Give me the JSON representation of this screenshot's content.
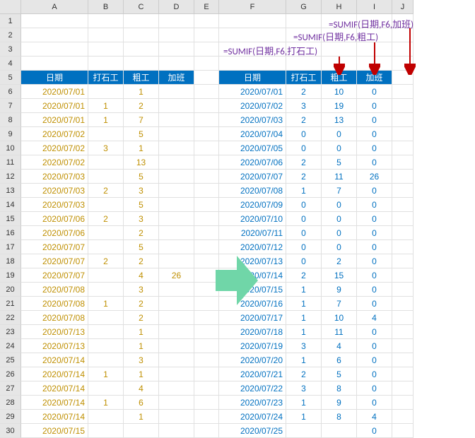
{
  "cols": [
    "A",
    "B",
    "C",
    "D",
    "E",
    "F",
    "G",
    "H",
    "I",
    "J"
  ],
  "row_numbers": [
    1,
    2,
    3,
    4,
    5,
    6,
    7,
    8,
    9,
    10,
    11,
    12,
    13,
    14,
    15,
    16,
    17,
    18,
    19,
    20,
    21,
    22,
    23,
    24,
    25,
    26,
    27,
    28,
    29,
    30
  ],
  "formulas": {
    "f1": "=SUMIF(日期,F6,加班)",
    "f2": "=SUMIF(日期,F6,粗工)",
    "f3": "=SUMIF(日期,F6,打石工)"
  },
  "headers": {
    "left_date": "日期",
    "left_a": "打石工",
    "left_b": "粗工",
    "left_c": "加班",
    "right_date": "日期",
    "right_a": "打石工",
    "right_b": "粗工",
    "right_c": "加班"
  },
  "left_rows": [
    {
      "d": "2020/07/01",
      "a": "",
      "b": "1",
      "c": ""
    },
    {
      "d": "2020/07/01",
      "a": "1",
      "b": "2",
      "c": ""
    },
    {
      "d": "2020/07/01",
      "a": "1",
      "b": "7",
      "c": ""
    },
    {
      "d": "2020/07/02",
      "a": "",
      "b": "5",
      "c": ""
    },
    {
      "d": "2020/07/02",
      "a": "3",
      "b": "1",
      "c": ""
    },
    {
      "d": "2020/07/02",
      "a": "",
      "b": "13",
      "c": ""
    },
    {
      "d": "2020/07/03",
      "a": "",
      "b": "5",
      "c": ""
    },
    {
      "d": "2020/07/03",
      "a": "2",
      "b": "3",
      "c": ""
    },
    {
      "d": "2020/07/03",
      "a": "",
      "b": "5",
      "c": ""
    },
    {
      "d": "2020/07/06",
      "a": "2",
      "b": "3",
      "c": ""
    },
    {
      "d": "2020/07/06",
      "a": "",
      "b": "2",
      "c": ""
    },
    {
      "d": "2020/07/07",
      "a": "",
      "b": "5",
      "c": ""
    },
    {
      "d": "2020/07/07",
      "a": "2",
      "b": "2",
      "c": ""
    },
    {
      "d": "2020/07/07",
      "a": "",
      "b": "4",
      "c": "26"
    },
    {
      "d": "2020/07/08",
      "a": "",
      "b": "3",
      "c": ""
    },
    {
      "d": "2020/07/08",
      "a": "1",
      "b": "2",
      "c": ""
    },
    {
      "d": "2020/07/08",
      "a": "",
      "b": "2",
      "c": ""
    },
    {
      "d": "2020/07/13",
      "a": "",
      "b": "1",
      "c": ""
    },
    {
      "d": "2020/07/13",
      "a": "",
      "b": "1",
      "c": ""
    },
    {
      "d": "2020/07/14",
      "a": "",
      "b": "3",
      "c": ""
    },
    {
      "d": "2020/07/14",
      "a": "1",
      "b": "1",
      "c": ""
    },
    {
      "d": "2020/07/14",
      "a": "",
      "b": "4",
      "c": ""
    },
    {
      "d": "2020/07/14",
      "a": "1",
      "b": "6",
      "c": ""
    },
    {
      "d": "2020/07/14",
      "a": "",
      "b": "1",
      "c": ""
    },
    {
      "d": "2020/07/15",
      "a": "",
      "b": "",
      "c": ""
    }
  ],
  "right_rows": [
    {
      "d": "2020/07/01",
      "a": "2",
      "b": "10",
      "c": "0"
    },
    {
      "d": "2020/07/02",
      "a": "3",
      "b": "19",
      "c": "0"
    },
    {
      "d": "2020/07/03",
      "a": "2",
      "b": "13",
      "c": "0"
    },
    {
      "d": "2020/07/04",
      "a": "0",
      "b": "0",
      "c": "0"
    },
    {
      "d": "2020/07/05",
      "a": "0",
      "b": "0",
      "c": "0"
    },
    {
      "d": "2020/07/06",
      "a": "2",
      "b": "5",
      "c": "0"
    },
    {
      "d": "2020/07/07",
      "a": "2",
      "b": "11",
      "c": "26"
    },
    {
      "d": "2020/07/08",
      "a": "1",
      "b": "7",
      "c": "0"
    },
    {
      "d": "2020/07/09",
      "a": "0",
      "b": "0",
      "c": "0"
    },
    {
      "d": "2020/07/10",
      "a": "0",
      "b": "0",
      "c": "0"
    },
    {
      "d": "2020/07/11",
      "a": "0",
      "b": "0",
      "c": "0"
    },
    {
      "d": "2020/07/12",
      "a": "0",
      "b": "0",
      "c": "0"
    },
    {
      "d": "2020/07/13",
      "a": "0",
      "b": "2",
      "c": "0"
    },
    {
      "d": "2020/07/14",
      "a": "2",
      "b": "15",
      "c": "0"
    },
    {
      "d": "2020/07/15",
      "a": "1",
      "b": "9",
      "c": "0"
    },
    {
      "d": "2020/07/16",
      "a": "1",
      "b": "7",
      "c": "0"
    },
    {
      "d": "2020/07/17",
      "a": "1",
      "b": "10",
      "c": "4"
    },
    {
      "d": "2020/07/18",
      "a": "1",
      "b": "11",
      "c": "0"
    },
    {
      "d": "2020/07/19",
      "a": "3",
      "b": "4",
      "c": "0"
    },
    {
      "d": "2020/07/20",
      "a": "1",
      "b": "6",
      "c": "0"
    },
    {
      "d": "2020/07/21",
      "a": "2",
      "b": "5",
      "c": "0"
    },
    {
      "d": "2020/07/22",
      "a": "3",
      "b": "8",
      "c": "0"
    },
    {
      "d": "2020/07/23",
      "a": "1",
      "b": "9",
      "c": "0"
    },
    {
      "d": "2020/07/24",
      "a": "1",
      "b": "8",
      "c": "4"
    },
    {
      "d": "2020/07/25",
      "a": "",
      "b": "",
      "c": "0"
    }
  ]
}
